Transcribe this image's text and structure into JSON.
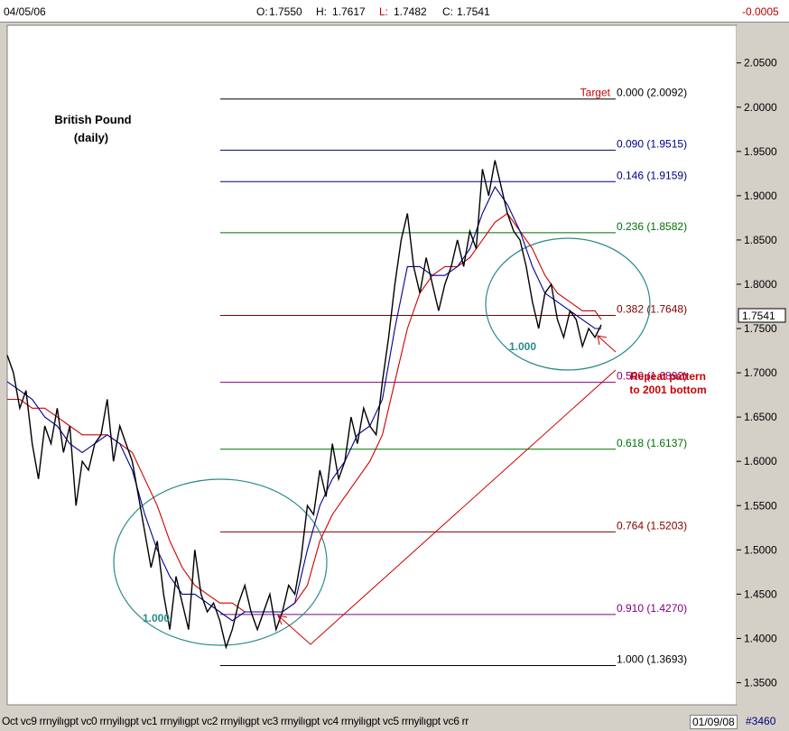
{
  "header": {
    "date": "04/05/06",
    "open_label": "O:",
    "open_value": "1.7550",
    "high_label": "H:",
    "high_value": "1.7617",
    "low_label": "L:",
    "low_value": "1.7482",
    "close_label": "C:",
    "close_value": "1.7541",
    "change": "-0.0005"
  },
  "footer": {
    "x_axis_text": "Oct vc9 rrnyilıgpt vc0 rrnyilıgpt vc1 rrnyilıgpt vc2 rrnyilıgpt vc3 rrnyilıgpt vc4 rrnyilıgpt vc5 rrnyilıgpt vc6 rr",
    "date": "01/09/08",
    "id": "#3460"
  },
  "chart_data": {
    "type": "line",
    "title": "British Pound",
    "subtitle": "(daily)",
    "ylim": [
      1.325,
      2.0925
    ],
    "y_ticks": [
      1.35,
      1.4,
      1.45,
      1.5,
      1.55,
      1.6,
      1.65,
      1.7,
      1.75,
      1.8,
      1.85,
      1.9,
      1.95,
      2.0,
      2.05
    ],
    "y_tick_labels": [
      "1.3500",
      "1.4000",
      "1.4500",
      "1.5000",
      "1.5500",
      "1.6000",
      "1.6500",
      "1.7000",
      "1.7500",
      "1.8000",
      "1.8500",
      "1.9000",
      "1.9500",
      "2.0000",
      "2.0500"
    ],
    "last_price_label": "1.7541",
    "fib_levels": [
      {
        "ratio": "0.000",
        "value": 2.0092,
        "label": "0.000 (2.0092)",
        "color": "#000000",
        "prefix": "Target",
        "prefix_color": "#cc0000"
      },
      {
        "ratio": "0.090",
        "value": 1.9515,
        "label": "0.090 (1.9515)",
        "color": "#000080"
      },
      {
        "ratio": "0.146",
        "value": 1.9159,
        "label": "0.146 (1.9159)",
        "color": "#000080"
      },
      {
        "ratio": "0.236",
        "value": 1.8582,
        "label": "0.236 (1.8582)",
        "color": "#007000"
      },
      {
        "ratio": "0.382",
        "value": 1.7648,
        "label": "0.382 (1.7648)",
        "color": "#800000"
      },
      {
        "ratio": "0.500",
        "value": 1.6892,
        "label": "0.500 (1.6892)",
        "color": "#800080"
      },
      {
        "ratio": "0.618",
        "value": 1.6137,
        "label": "0.618 (1.6137)",
        "color": "#007000"
      },
      {
        "ratio": "0.764",
        "value": 1.5203,
        "label": "0.764 (1.5203)",
        "color": "#800000"
      },
      {
        "ratio": "0.910",
        "value": 1.427,
        "label": "0.910 (1.4270)",
        "color": "#800080"
      },
      {
        "ratio": "1.000",
        "value": 1.3693,
        "label": "1.000 (1.3693)",
        "color": "#000000"
      }
    ],
    "price_series": [
      [
        0,
        1.72
      ],
      [
        3,
        1.7
      ],
      [
        6,
        1.66
      ],
      [
        9,
        1.68
      ],
      [
        12,
        1.62
      ],
      [
        15,
        1.58
      ],
      [
        18,
        1.64
      ],
      [
        21,
        1.62
      ],
      [
        24,
        1.66
      ],
      [
        27,
        1.61
      ],
      [
        30,
        1.64
      ],
      [
        33,
        1.55
      ],
      [
        36,
        1.6
      ],
      [
        39,
        1.59
      ],
      [
        42,
        1.62
      ],
      [
        45,
        1.63
      ],
      [
        48,
        1.67
      ],
      [
        51,
        1.6
      ],
      [
        54,
        1.64
      ],
      [
        57,
        1.62
      ],
      [
        60,
        1.6
      ],
      [
        63,
        1.56
      ],
      [
        66,
        1.52
      ],
      [
        69,
        1.48
      ],
      [
        72,
        1.51
      ],
      [
        75,
        1.45
      ],
      [
        78,
        1.41
      ],
      [
        81,
        1.47
      ],
      [
        84,
        1.44
      ],
      [
        87,
        1.41
      ],
      [
        90,
        1.5
      ],
      [
        93,
        1.45
      ],
      [
        96,
        1.43
      ],
      [
        99,
        1.44
      ],
      [
        102,
        1.42
      ],
      [
        105,
        1.39
      ],
      [
        108,
        1.41
      ],
      [
        111,
        1.44
      ],
      [
        114,
        1.46
      ],
      [
        117,
        1.43
      ],
      [
        120,
        1.41
      ],
      [
        123,
        1.43
      ],
      [
        126,
        1.45
      ],
      [
        129,
        1.41
      ],
      [
        132,
        1.43
      ],
      [
        135,
        1.46
      ],
      [
        138,
        1.45
      ],
      [
        141,
        1.49
      ],
      [
        144,
        1.55
      ],
      [
        147,
        1.54
      ],
      [
        150,
        1.59
      ],
      [
        153,
        1.56
      ],
      [
        156,
        1.62
      ],
      [
        159,
        1.58
      ],
      [
        162,
        1.6
      ],
      [
        165,
        1.65
      ],
      [
        168,
        1.62
      ],
      [
        171,
        1.66
      ],
      [
        174,
        1.64
      ],
      [
        177,
        1.63
      ],
      [
        180,
        1.69
      ],
      [
        183,
        1.74
      ],
      [
        186,
        1.8
      ],
      [
        189,
        1.85
      ],
      [
        192,
        1.88
      ],
      [
        195,
        1.82
      ],
      [
        198,
        1.79
      ],
      [
        201,
        1.83
      ],
      [
        204,
        1.8
      ],
      [
        207,
        1.77
      ],
      [
        210,
        1.8
      ],
      [
        213,
        1.82
      ],
      [
        216,
        1.85
      ],
      [
        219,
        1.82
      ],
      [
        222,
        1.86
      ],
      [
        225,
        1.84
      ],
      [
        228,
        1.93
      ],
      [
        231,
        1.9
      ],
      [
        234,
        1.94
      ],
      [
        237,
        1.91
      ],
      [
        240,
        1.88
      ],
      [
        243,
        1.86
      ],
      [
        246,
        1.85
      ],
      [
        249,
        1.82
      ],
      [
        252,
        1.78
      ],
      [
        255,
        1.75
      ],
      [
        258,
        1.79
      ],
      [
        261,
        1.8
      ],
      [
        264,
        1.76
      ],
      [
        267,
        1.74
      ],
      [
        270,
        1.77
      ],
      [
        273,
        1.76
      ],
      [
        276,
        1.73
      ],
      [
        279,
        1.75
      ],
      [
        282,
        1.74
      ],
      [
        285,
        1.7541
      ]
    ],
    "x_max": 285,
    "ma_fast": [
      [
        0,
        1.69
      ],
      [
        6,
        1.68
      ],
      [
        12,
        1.67
      ],
      [
        18,
        1.65
      ],
      [
        24,
        1.64
      ],
      [
        30,
        1.62
      ],
      [
        36,
        1.61
      ],
      [
        42,
        1.62
      ],
      [
        48,
        1.63
      ],
      [
        54,
        1.62
      ],
      [
        60,
        1.59
      ],
      [
        66,
        1.54
      ],
      [
        72,
        1.5
      ],
      [
        78,
        1.47
      ],
      [
        84,
        1.45
      ],
      [
        90,
        1.45
      ],
      [
        96,
        1.44
      ],
      [
        102,
        1.43
      ],
      [
        108,
        1.42
      ],
      [
        114,
        1.43
      ],
      [
        120,
        1.43
      ],
      [
        126,
        1.43
      ],
      [
        132,
        1.43
      ],
      [
        138,
        1.44
      ],
      [
        144,
        1.5
      ],
      [
        150,
        1.55
      ],
      [
        156,
        1.58
      ],
      [
        162,
        1.6
      ],
      [
        168,
        1.63
      ],
      [
        174,
        1.64
      ],
      [
        180,
        1.67
      ],
      [
        186,
        1.75
      ],
      [
        192,
        1.82
      ],
      [
        198,
        1.82
      ],
      [
        204,
        1.81
      ],
      [
        210,
        1.81
      ],
      [
        216,
        1.82
      ],
      [
        222,
        1.84
      ],
      [
        228,
        1.88
      ],
      [
        234,
        1.91
      ],
      [
        240,
        1.89
      ],
      [
        246,
        1.86
      ],
      [
        252,
        1.82
      ],
      [
        258,
        1.79
      ],
      [
        264,
        1.78
      ],
      [
        270,
        1.77
      ],
      [
        276,
        1.76
      ],
      [
        282,
        1.75
      ],
      [
        285,
        1.75
      ]
    ],
    "ma_slow": [
      [
        0,
        1.67
      ],
      [
        6,
        1.67
      ],
      [
        12,
        1.66
      ],
      [
        18,
        1.66
      ],
      [
        24,
        1.65
      ],
      [
        30,
        1.64
      ],
      [
        36,
        1.63
      ],
      [
        42,
        1.63
      ],
      [
        48,
        1.63
      ],
      [
        54,
        1.62
      ],
      [
        60,
        1.61
      ],
      [
        66,
        1.58
      ],
      [
        72,
        1.55
      ],
      [
        78,
        1.51
      ],
      [
        84,
        1.48
      ],
      [
        90,
        1.46
      ],
      [
        96,
        1.45
      ],
      [
        102,
        1.44
      ],
      [
        108,
        1.44
      ],
      [
        114,
        1.43
      ],
      [
        120,
        1.43
      ],
      [
        126,
        1.43
      ],
      [
        132,
        1.43
      ],
      [
        138,
        1.44
      ],
      [
        144,
        1.46
      ],
      [
        150,
        1.51
      ],
      [
        156,
        1.54
      ],
      [
        162,
        1.56
      ],
      [
        168,
        1.58
      ],
      [
        174,
        1.6
      ],
      [
        180,
        1.63
      ],
      [
        186,
        1.69
      ],
      [
        192,
        1.75
      ],
      [
        198,
        1.79
      ],
      [
        204,
        1.81
      ],
      [
        210,
        1.82
      ],
      [
        216,
        1.82
      ],
      [
        222,
        1.83
      ],
      [
        228,
        1.85
      ],
      [
        234,
        1.87
      ],
      [
        240,
        1.88
      ],
      [
        246,
        1.86
      ],
      [
        252,
        1.84
      ],
      [
        258,
        1.81
      ],
      [
        264,
        1.79
      ],
      [
        270,
        1.78
      ],
      [
        276,
        1.77
      ],
      [
        282,
        1.77
      ],
      [
        285,
        1.76
      ]
    ],
    "colors": {
      "price": "#000000",
      "ma_fast": "#000090",
      "ma_slow": "#d00000",
      "fib_gray": "#000000",
      "circle": "#2a8a8a",
      "annotation": "#cc0000"
    },
    "circle_labels": [
      "1.000",
      "1.000"
    ],
    "annotation_line1": "Repeat pattern",
    "annotation_line2": "to 2001 bottom"
  }
}
